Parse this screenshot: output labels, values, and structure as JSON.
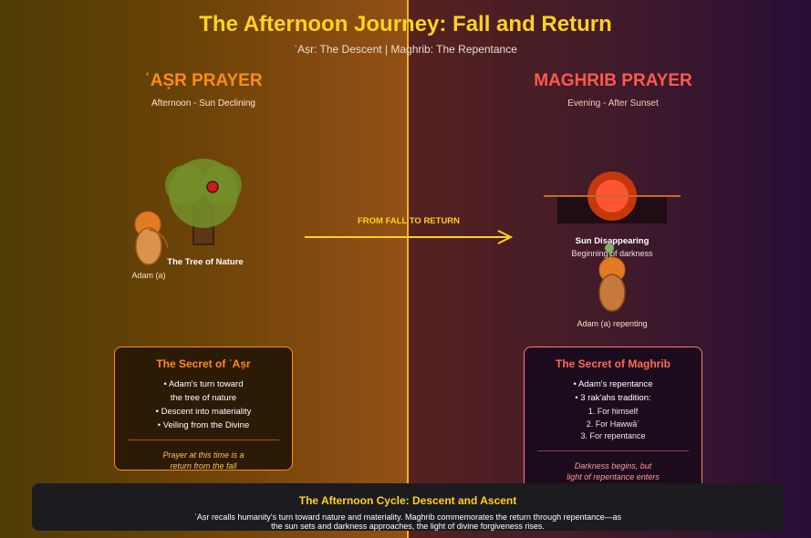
{
  "header": {
    "title": "The Afternoon Journey: Fall and Return",
    "subtitle": "ʿAṣr: The Descent | Maghrib: The Repentance"
  },
  "colors": {
    "gold": "#ffd21f",
    "asr": "#ff8c1a",
    "maghrib": "#ff5a4a",
    "divider": "#f2b21a"
  },
  "asr": {
    "title": "ʿAṢR PRAYER",
    "subtitle": "Afternoon - Sun Declining",
    "tree_label": "The Tree of Nature",
    "figure_label": "Adam (a)",
    "card": {
      "title": "The Secret of ʿAṣr",
      "items": [
        "• Adam's turn toward",
        "the tree of nature",
        "• Descent into materiality",
        "• Veiling from the Divine"
      ],
      "note_line1": "Prayer at this time is a",
      "note_line2": "return from the fall"
    }
  },
  "arrow": {
    "label": "FROM FALL TO RETURN"
  },
  "maghrib": {
    "title": "MAGHRIB PRAYER",
    "subtitle": "Evening - After Sunset",
    "sun_label": "Sun Disappearing",
    "sun_sublabel": "Beginning of darkness",
    "figure_label": "Adam (a) repenting",
    "card": {
      "title": "The Secret of Maghrib",
      "items": [
        "• Adam's repentance",
        "• 3 rak'ahs tradition:"
      ],
      "subitems": [
        "1. For himself",
        "2. For Hawwāʾ",
        "3. For repentance"
      ],
      "note_line1": "Darkness begins, but",
      "note_line2": "light of repentance enters"
    }
  },
  "footer": {
    "title": "The Afternoon Cycle: Descent and Ascent",
    "text": "ʿAṣr recalls humanity's turn toward nature and materiality. Maghrib commemorates the return through repentance—as the sun sets and darkness approaches, the light of divine forgiveness rises."
  }
}
